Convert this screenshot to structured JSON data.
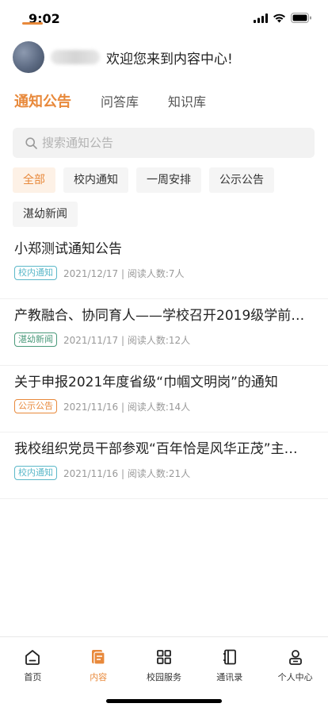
{
  "status_bar": {
    "time": "9:02"
  },
  "header": {
    "welcome_text": "欢迎您来到内容中心!"
  },
  "tabs": [
    {
      "label": "通知公告",
      "active": true
    },
    {
      "label": "问答库",
      "active": false
    },
    {
      "label": "知识库",
      "active": false
    }
  ],
  "search": {
    "placeholder": "搜索通知公告",
    "icon": "search-icon"
  },
  "filters": [
    {
      "label": "全部",
      "active": true
    },
    {
      "label": "校内通知",
      "active": false
    },
    {
      "label": "一周安排",
      "active": false
    },
    {
      "label": "公示公告",
      "active": false
    },
    {
      "label": "湛幼新闻",
      "active": false
    }
  ],
  "notices": [
    {
      "title": "小郑测试通知公告",
      "tag": "校内通知",
      "meta": "2021/12/17 | 阅读人数:7人"
    },
    {
      "title": "产教融合、协同育人——学校召开2019级学前…",
      "tag": "湛幼新闻",
      "meta": "2021/11/17 | 阅读人数:12人"
    },
    {
      "title": "关于申报2021年度省级“巾帼文明岗”的通知",
      "tag": "公示公告",
      "meta": "2021/11/16 | 阅读人数:14人"
    },
    {
      "title": "我校组织党员干部参观“百年恰是风华正茂”主…",
      "tag": "校内通知",
      "meta": "2021/11/16 | 阅读人数:21人"
    }
  ],
  "tag_colors": {
    "校内通知": "#5bb8c9",
    "湛幼新闻": "#4a9a7a",
    "公示公告": "#e8893b"
  },
  "accent_color": "#e8893b",
  "tabbar": [
    {
      "label": "首页",
      "icon": "home-icon",
      "active": false
    },
    {
      "label": "内容",
      "icon": "content-icon",
      "active": true
    },
    {
      "label": "校园服务",
      "icon": "grid-icon",
      "active": false
    },
    {
      "label": "通讯录",
      "icon": "contacts-icon",
      "active": false
    },
    {
      "label": "个人中心",
      "icon": "profile-icon",
      "active": false
    }
  ]
}
